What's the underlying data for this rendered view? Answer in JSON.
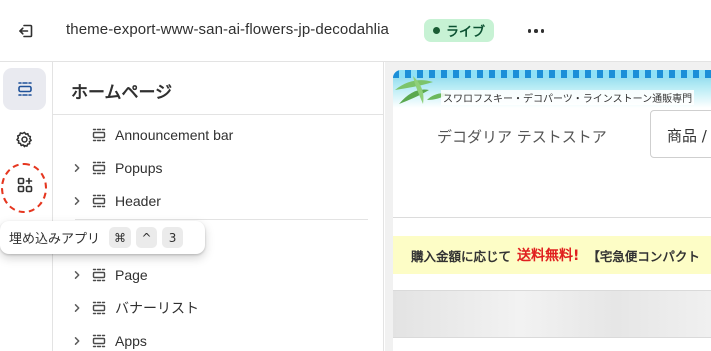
{
  "topbar": {
    "exit_icon": "exit-icon",
    "theme_name": "theme-export-www-san-ai-flowers-jp-decodahlia",
    "status_badge": "ライブ",
    "status_color": "#c7f2d4",
    "more_icon": "ellipsis-icon"
  },
  "rail": {
    "items": [
      {
        "icon": "sections-icon",
        "active": true
      },
      {
        "icon": "gear-icon",
        "active": false
      },
      {
        "icon": "app-embeds-icon",
        "active": false
      }
    ],
    "highlight_color": "#e5361f"
  },
  "panel": {
    "title": "ホームページ",
    "rows": [
      {
        "label": "Announcement bar",
        "expandable": false,
        "icon": "section-icon"
      },
      {
        "label": "Popups",
        "expandable": true,
        "icon": "section-icon"
      },
      {
        "label": "Header",
        "expandable": true,
        "icon": "section-icon"
      },
      {
        "label": "Page",
        "expandable": true,
        "icon": "section-icon"
      },
      {
        "label": "バナーリスト",
        "expandable": true,
        "icon": "section-icon"
      },
      {
        "label": "Apps",
        "expandable": true,
        "icon": "section-icon"
      }
    ]
  },
  "tooltip": {
    "text": "埋め込みアプリ",
    "keys": [
      "⌘",
      "^",
      "3"
    ]
  },
  "preview": {
    "banner_text": "スワロフスキー・デコパーツ・ラインストーン通販専門",
    "store_name": "デコダリア テストストア",
    "search_placeholder": "商品 /",
    "promo_part1": "購入金額に応じて",
    "promo_part2": "送料無料!",
    "promo_part3": "【宅急便コンパクト"
  }
}
